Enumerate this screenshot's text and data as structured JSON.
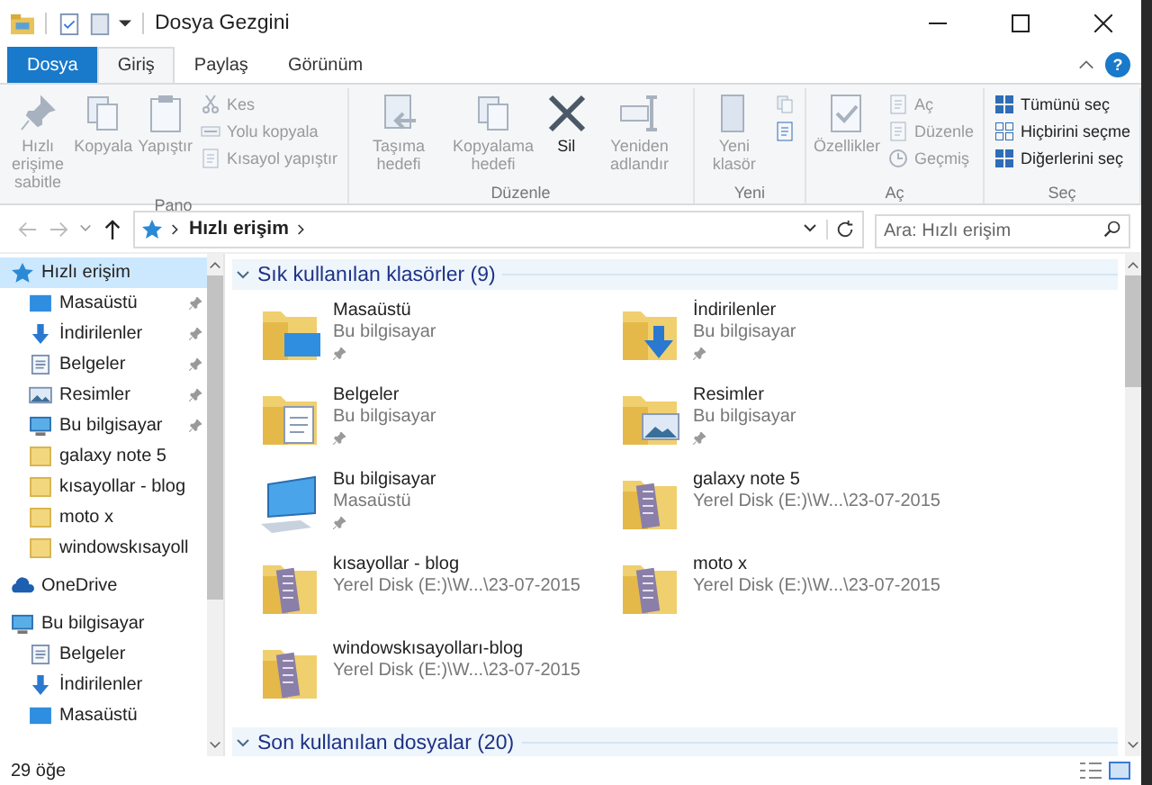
{
  "window": {
    "title": "Dosya Gezgini"
  },
  "tabs": [
    {
      "label": "Dosya",
      "kind": "file",
      "selected": false
    },
    {
      "label": "Giriş",
      "kind": "tab",
      "selected": true
    },
    {
      "label": "Paylaş",
      "kind": "tab",
      "selected": false
    },
    {
      "label": "Görünüm",
      "kind": "tab",
      "selected": false
    }
  ],
  "help_button": "?",
  "ribbon": {
    "groups": [
      {
        "label": "Pano",
        "items": [
          {
            "kind": "large",
            "label": "Hızlı erişime sabitle",
            "disabled": true
          },
          {
            "kind": "large",
            "label": "Kopyala",
            "disabled": true
          },
          {
            "kind": "large",
            "label": "Yapıştır",
            "disabled": true
          },
          {
            "kind": "small",
            "label": "Kes",
            "disabled": true
          },
          {
            "kind": "small",
            "label": "Yolu kopyala",
            "disabled": true
          },
          {
            "kind": "small",
            "label": "Kısayol yapıştır",
            "disabled": true
          }
        ]
      },
      {
        "label": "Düzenle",
        "items": [
          {
            "kind": "large",
            "label": "Taşıma hedefi",
            "disabled": true
          },
          {
            "kind": "large",
            "label": "Kopyalama hedefi",
            "disabled": true
          },
          {
            "kind": "large",
            "label": "Sil",
            "disabled": false
          },
          {
            "kind": "large",
            "label": "Yeniden adlandır",
            "disabled": true
          }
        ]
      },
      {
        "label": "Yeni",
        "items": [
          {
            "kind": "large",
            "label": "Yeni klasör",
            "disabled": true
          },
          {
            "kind": "small",
            "disabled": true
          },
          {
            "kind": "small",
            "disabled": false
          }
        ]
      },
      {
        "label": "Aç",
        "items": [
          {
            "kind": "large",
            "label": "Özellikler",
            "disabled": true
          },
          {
            "kind": "small",
            "label": "Aç",
            "disabled": true
          },
          {
            "kind": "small",
            "label": "Düzenle",
            "disabled": true
          },
          {
            "kind": "small",
            "label": "Geçmiş",
            "disabled": true
          }
        ]
      },
      {
        "label": "Seç",
        "items": [
          {
            "kind": "small",
            "label": "Tümünü seç",
            "disabled": false
          },
          {
            "kind": "small",
            "label": "Hiçbirini seçme",
            "disabled": false
          },
          {
            "kind": "small",
            "label": "Diğerlerini seç",
            "disabled": false
          }
        ]
      }
    ]
  },
  "address": {
    "path": "Hızlı erişim",
    "search_placeholder": "Ara: Hızlı erişim"
  },
  "sidebar": {
    "items": [
      {
        "label": "Hızlı erişim",
        "kind": "quick_access",
        "selected": true,
        "children": [
          {
            "label": "Masaüstü",
            "kind": "desktop",
            "pinned": true,
            "selected": false
          },
          {
            "label": "İndirilenler",
            "kind": "downloads",
            "pinned": true,
            "selected": false
          },
          {
            "label": "Belgeler",
            "kind": "documents",
            "pinned": true,
            "selected": false
          },
          {
            "label": "Resimler",
            "kind": "pictures",
            "pinned": true,
            "selected": false
          },
          {
            "label": "Bu bilgisayar",
            "kind": "computer",
            "pinned": true,
            "selected": false
          },
          {
            "label": "galaxy note 5",
            "kind": "folder",
            "pinned": false,
            "selected": false
          },
          {
            "label": "kısayollar - blog",
            "kind": "folder",
            "pinned": false,
            "selected": false
          },
          {
            "label": "moto x",
            "kind": "folder",
            "pinned": false,
            "selected": false
          },
          {
            "label": "windowskısayoll",
            "kind": "folder",
            "pinned": false,
            "selected": false
          }
        ]
      },
      {
        "label": "OneDrive",
        "kind": "onedrive",
        "selected": false
      },
      {
        "label": "Bu bilgisayar",
        "kind": "computer",
        "selected": false,
        "children": [
          {
            "label": "Belgeler",
            "kind": "documents",
            "pinned": false,
            "selected": false
          },
          {
            "label": "İndirilenler",
            "kind": "downloads",
            "pinned": false,
            "selected": false
          },
          {
            "label": "Masaüstü",
            "kind": "desktop",
            "pinned": false,
            "selected": false
          }
        ]
      }
    ]
  },
  "sections": [
    {
      "title": "Sık kullanılan klasörler (9)",
      "expanded": true,
      "items": [
        {
          "name": "Masaüstü",
          "location": "Bu bilgisayar",
          "kind": "desktop",
          "pinned": true
        },
        {
          "name": "İndirilenler",
          "location": "Bu bilgisayar",
          "kind": "downloads",
          "pinned": true
        },
        {
          "name": "Belgeler",
          "location": "Bu bilgisayar",
          "kind": "documents",
          "pinned": true
        },
        {
          "name": "Resimler",
          "location": "Bu bilgisayar",
          "kind": "pictures",
          "pinned": true
        },
        {
          "name": "Bu bilgisayar",
          "location": "Masaüstü",
          "kind": "computer",
          "pinned": true
        },
        {
          "name": "galaxy note 5",
          "location": "Yerel Disk (E:)\\W...\\23-07-2015",
          "kind": "folder",
          "pinned": false
        },
        {
          "name": "kısayollar - blog",
          "location": "Yerel Disk (E:)\\W...\\23-07-2015",
          "kind": "folder",
          "pinned": false
        },
        {
          "name": "moto x",
          "location": "Yerel Disk (E:)\\W...\\23-07-2015",
          "kind": "folder",
          "pinned": false
        },
        {
          "name": "windowskısayolları-blog",
          "location": "Yerel Disk (E:)\\W...\\23-07-2015",
          "kind": "folder",
          "pinned": false
        }
      ]
    },
    {
      "title": "Son kullanılan dosyalar (20)",
      "expanded": true
    }
  ],
  "status_bar": {
    "count": "29 öğe"
  }
}
